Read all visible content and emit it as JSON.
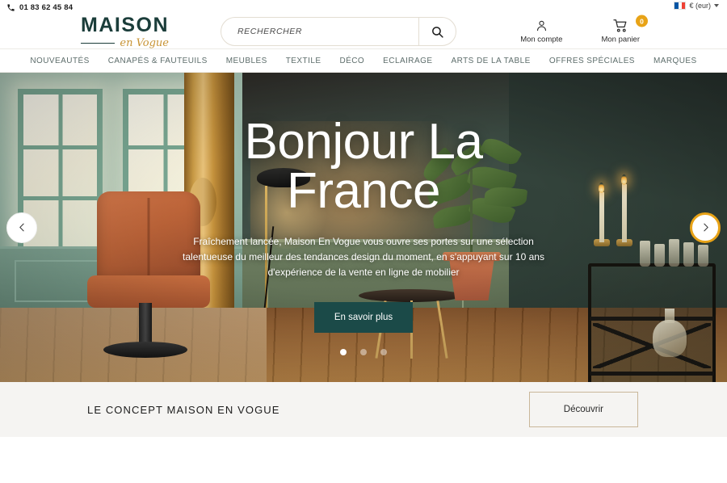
{
  "topbar": {
    "phone": "01 83 62 45 84",
    "phone_icon": "phone-icon",
    "flag": "french-flag-icon",
    "currency": "€ (eur)"
  },
  "header": {
    "logo_main": "MAISON",
    "logo_script": "en Vogue",
    "search": {
      "placeholder": "RECHERCHER",
      "value": "",
      "icon": "search-icon"
    },
    "actions": [
      {
        "label": "Mon compte",
        "icon": "user-icon"
      },
      {
        "label": "Mon panier",
        "icon": "cart-icon",
        "badge": "0"
      }
    ]
  },
  "nav": {
    "items": [
      {
        "label": "NOUVEAUTÉS"
      },
      {
        "label": "CANAPÉS & FAUTEUILS"
      },
      {
        "label": "MEUBLES"
      },
      {
        "label": "TEXTILE"
      },
      {
        "label": "DÉCO"
      },
      {
        "label": "ECLAIRAGE"
      },
      {
        "label": "ARTS DE LA TABLE"
      },
      {
        "label": "OFFRES SPÉCIALES"
      },
      {
        "label": "MARQUES"
      }
    ]
  },
  "hero": {
    "title_line1": "Bonjour La",
    "title_line2": "France",
    "description": "Fraîchement lancée, Maison En Vogue vous ouvre ses portes sur une sélection talentueuse du meilleur des tendances design du moment, en s'appuyant sur 10 ans d'expérience de la vente en ligne de mobilier",
    "cta_label": "En savoir plus",
    "prev_icon": "chevron-left-icon",
    "next_icon": "chevron-right-icon",
    "slides": 3,
    "active_slide": 1
  },
  "concept": {
    "title": "LE CONCEPT MAISON EN VOGUE",
    "button_label": "Découvrir"
  },
  "colors": {
    "brand_dark": "#1b3d3a",
    "brand_gold": "#c89435",
    "accent_orange": "#e8a317",
    "cta_teal": "#1b4a48",
    "nav_text": "#5d6d6b",
    "concept_bg": "#f5f4f2",
    "border_tan": "#c9b79a"
  }
}
